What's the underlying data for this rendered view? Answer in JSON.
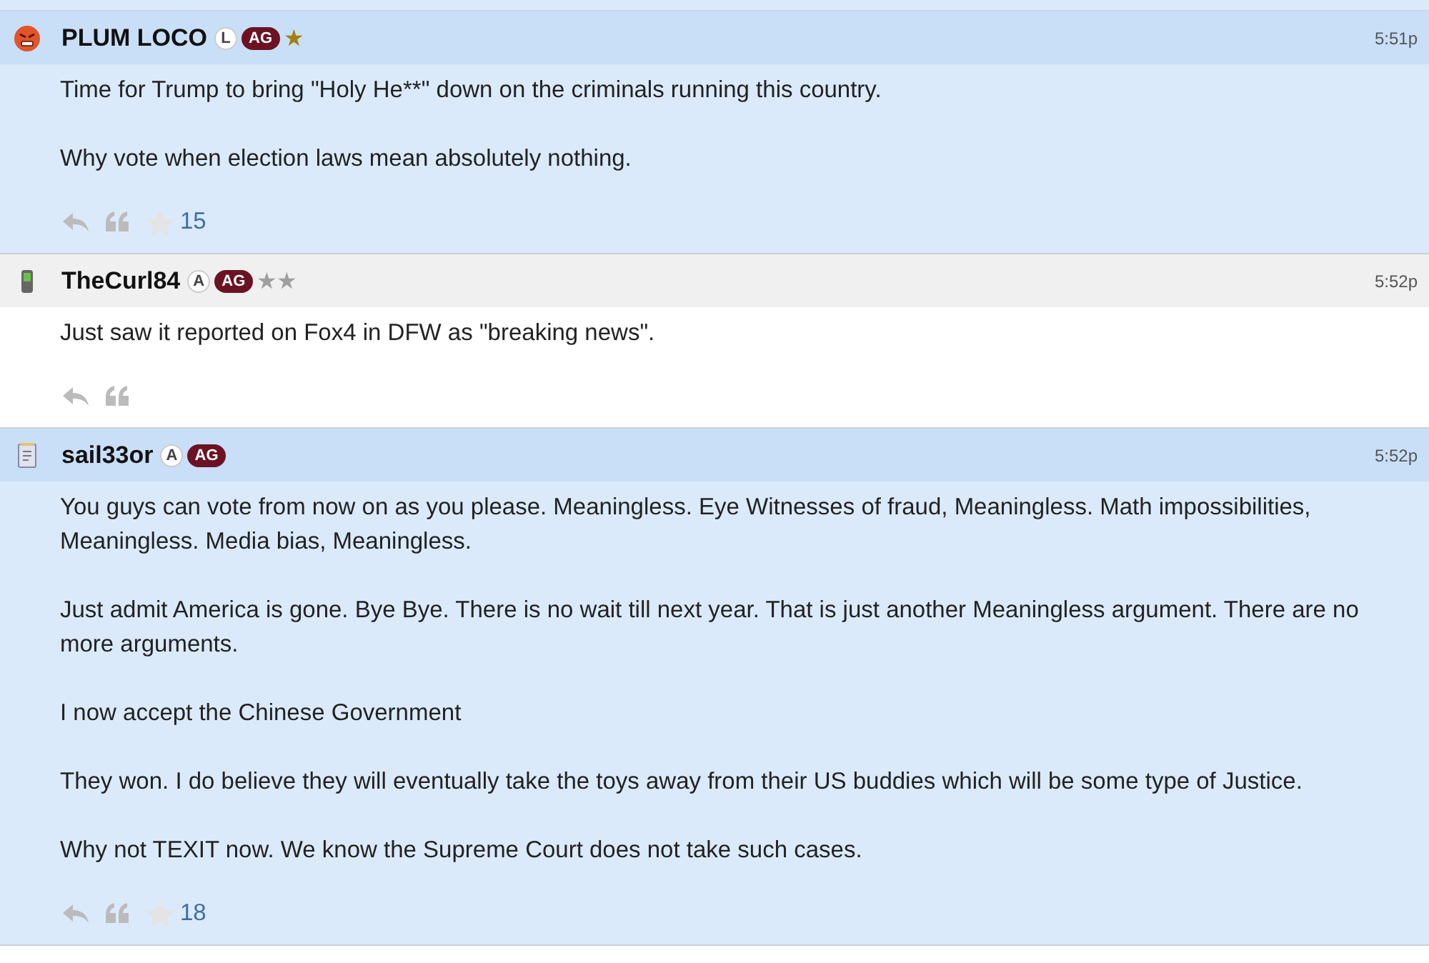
{
  "posts": [
    {
      "author": "PLUM LOCO",
      "avatar": {
        "kind": "angry-face"
      },
      "badges": [
        "L",
        "AG"
      ],
      "rank": {
        "text": "★",
        "color": "#a0800f"
      },
      "time": "5:51p",
      "highlighted": true,
      "paragraphs": [
        "Time for Trump to bring \"Holy He**\" down on the criminals running this country.",
        "Why vote when election laws mean absolutely nothing."
      ],
      "likes": "15"
    },
    {
      "author": "TheCurl84",
      "avatar": {
        "kind": "phone"
      },
      "badges": [
        "A",
        "AG"
      ],
      "rank": {
        "text": "★★",
        "color": "#a0a0a0"
      },
      "time": "5:52p",
      "highlighted": false,
      "paragraphs": [
        "Just saw it reported on Fox4 in DFW as \"breaking news\"."
      ]
    },
    {
      "author": "sail33or",
      "avatar": {
        "kind": "notepad"
      },
      "badges": [
        "A",
        "AG"
      ],
      "time": "5:52p",
      "highlighted": true,
      "paragraphs": [
        "You guys can vote from now on as you please. Meaningless. Eye Witnesses of fraud, Meaningless. Math impossibilities, Meaningless. Media bias, Meaningless.",
        "Just admit America is gone. Bye Bye. There is no wait till next year. That is just another Meaningless argument. There are no more arguments.",
        "I now accept the Chinese Government",
        "They won. I do believe they will eventually take the toys away from their US buddies which will be some type of Justice.",
        "Why not TEXIT now. We know the Supreme Court does not take such cases."
      ],
      "likes": "18"
    }
  ]
}
